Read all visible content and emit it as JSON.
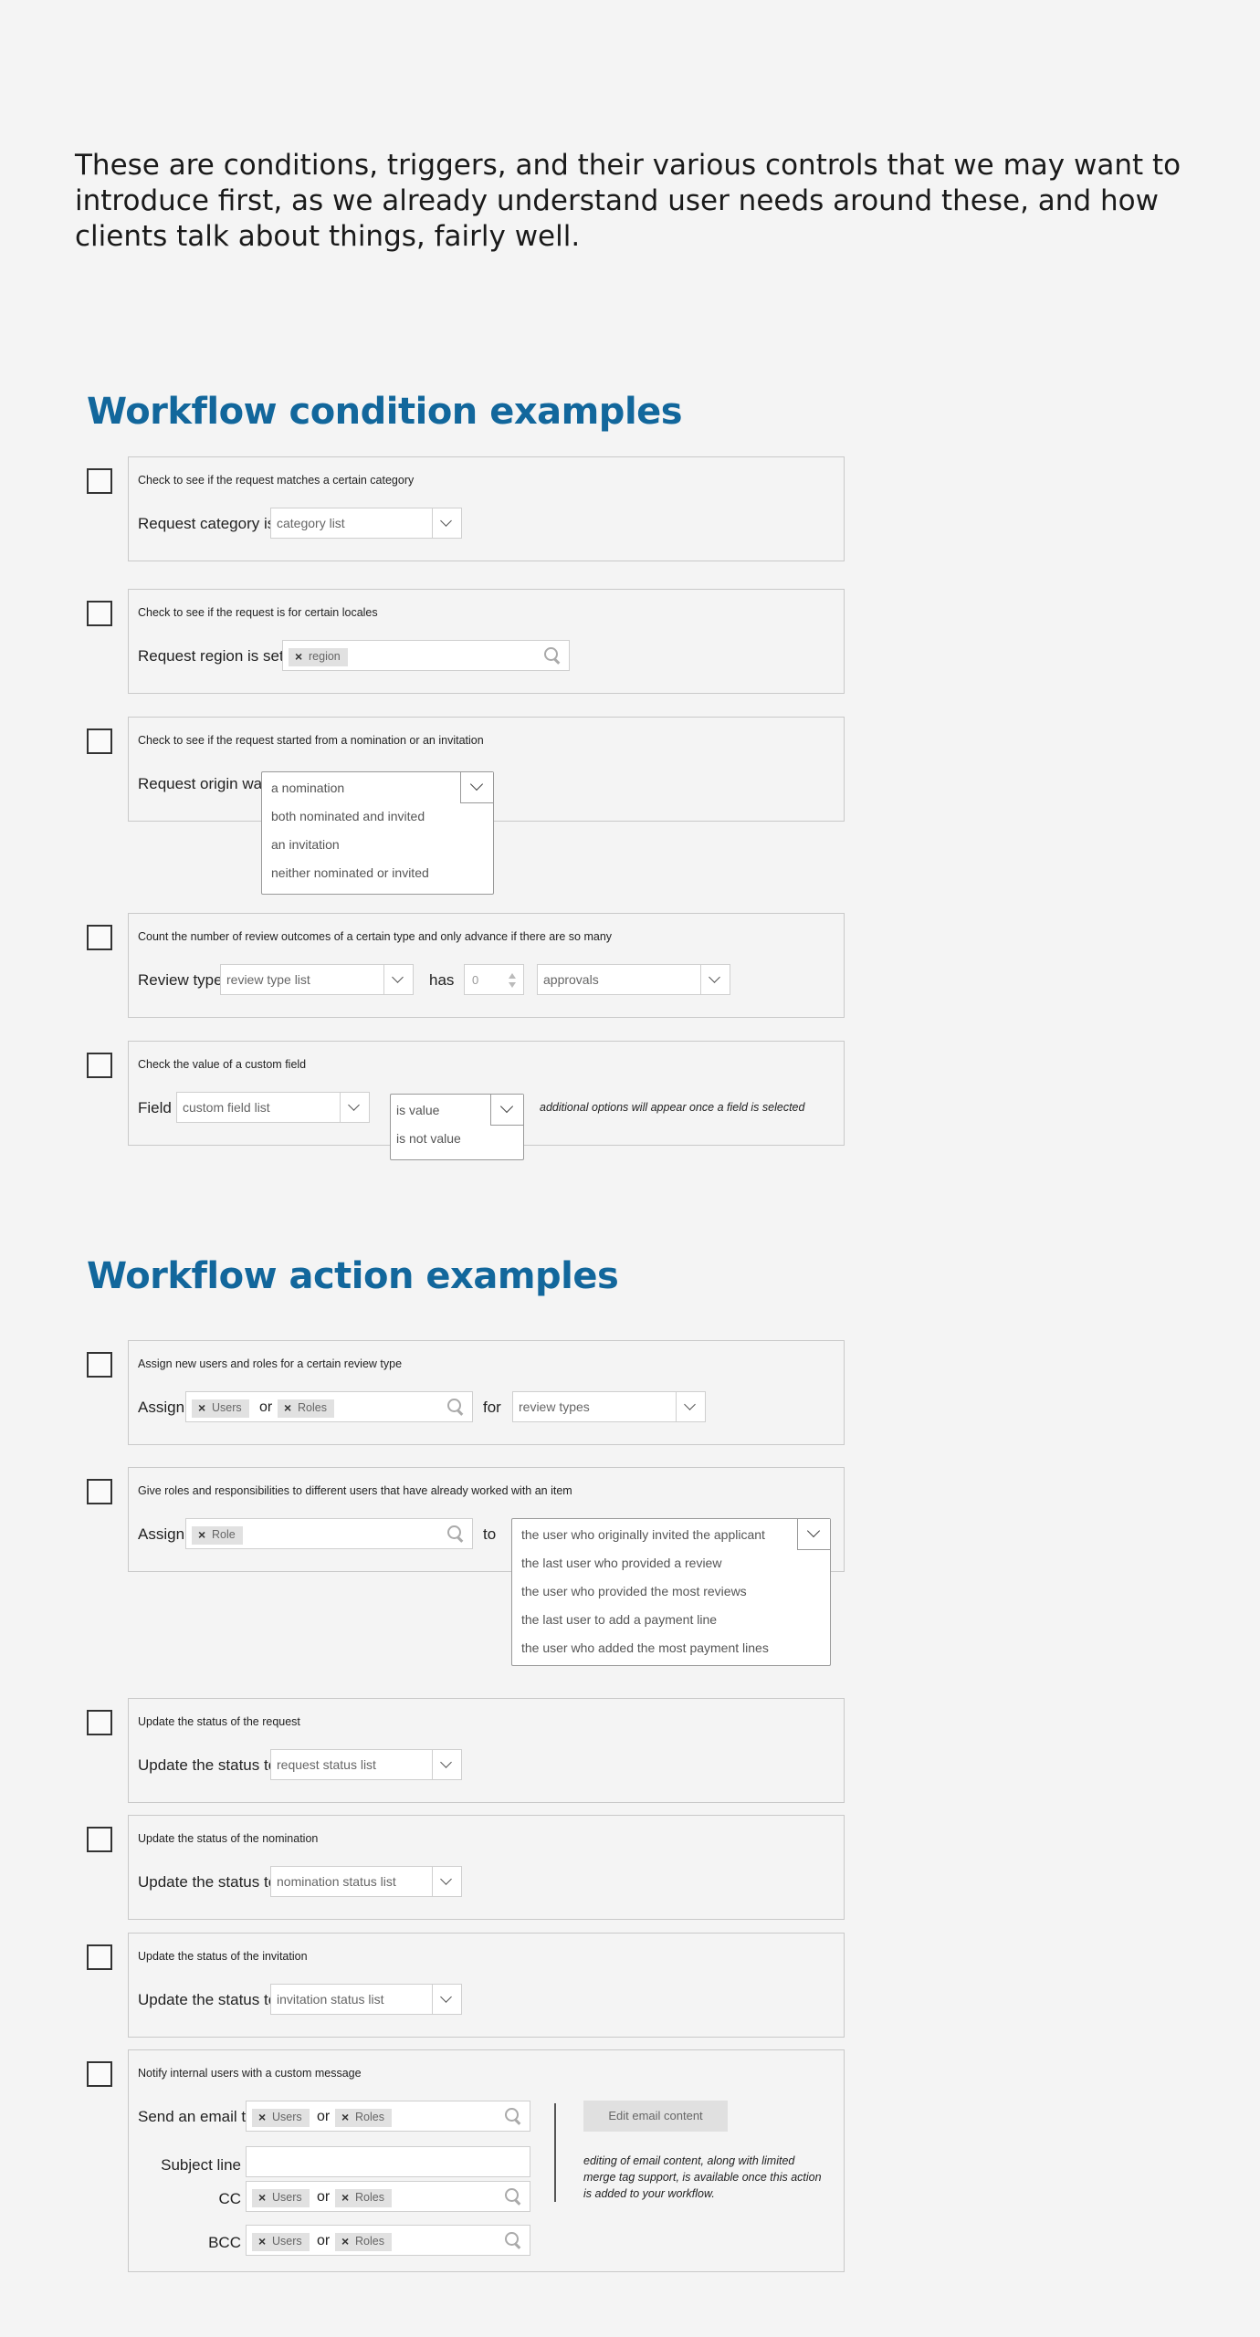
{
  "intro": "These are conditions, triggers, and their various controls that we may want to introduce first, as we already understand user needs around these, and how clients talk about things, fairly well.",
  "conditions_title": "Workflow condition examples",
  "actions_title": "Workflow action examples",
  "conditions": {
    "c1": {
      "desc": "Check to see if the request matches a certain category",
      "label": "Request category is",
      "select": "category list"
    },
    "c2": {
      "desc": "Check to see if the request is for certain locales",
      "label": "Request region is set t",
      "tag": "region"
    },
    "c3": {
      "desc": "Check to see if the request started from a nomination or an invitation",
      "label": "Request origin was",
      "options": [
        "a nomination",
        "both nominated and invited",
        "an invitation",
        "neither nominated or invited"
      ]
    },
    "c4": {
      "desc": "Count the number of review outcomes of a certain type and only advance if there are so many",
      "label": "Review type",
      "select1": "review type list",
      "has": "has",
      "count": "0",
      "select2": "approvals"
    },
    "c5": {
      "desc": "Check the value of a custom field",
      "label": "Field",
      "select": "custom field list",
      "options": [
        "is value",
        "is not value"
      ],
      "note": "additional options will appear once a field is selected"
    }
  },
  "actions": {
    "a1": {
      "desc": "Assign new users and roles for a certain review type",
      "label": "Assign",
      "tag1": "Users",
      "or": "or",
      "tag2": "Roles",
      "for": "for",
      "select": "review types"
    },
    "a2": {
      "desc": "Give roles and responsibilities to different users that have already worked with an item",
      "label": "Assign",
      "tag": "Role",
      "to": "to",
      "options": [
        "the user who originally invited the applicant",
        "the last user who provided a review",
        "the user who provided the most reviews",
        "the last user to add a payment line",
        "the user who added the most payment lines"
      ]
    },
    "a3": {
      "desc": "Update the status of the request",
      "label": "Update the status to",
      "select": "request status list"
    },
    "a4": {
      "desc": "Update the status of the nomination",
      "label": "Update the status to",
      "select": "nomination status list"
    },
    "a5": {
      "desc": "Update the status of the invitation",
      "label": "Update the status to",
      "select": "invitation status list"
    },
    "a6": {
      "desc": "Notify internal users with a custom message",
      "send_label": "Send an email to",
      "subject_label": "Subject line",
      "cc_label": "CC",
      "bcc_label": "BCC",
      "tag_users": "Users",
      "tag_roles": "Roles",
      "or": "or",
      "edit_button": "Edit email content",
      "note": "editing of email content, along with limited merge tag support, is available once this action is added to your workflow."
    }
  }
}
